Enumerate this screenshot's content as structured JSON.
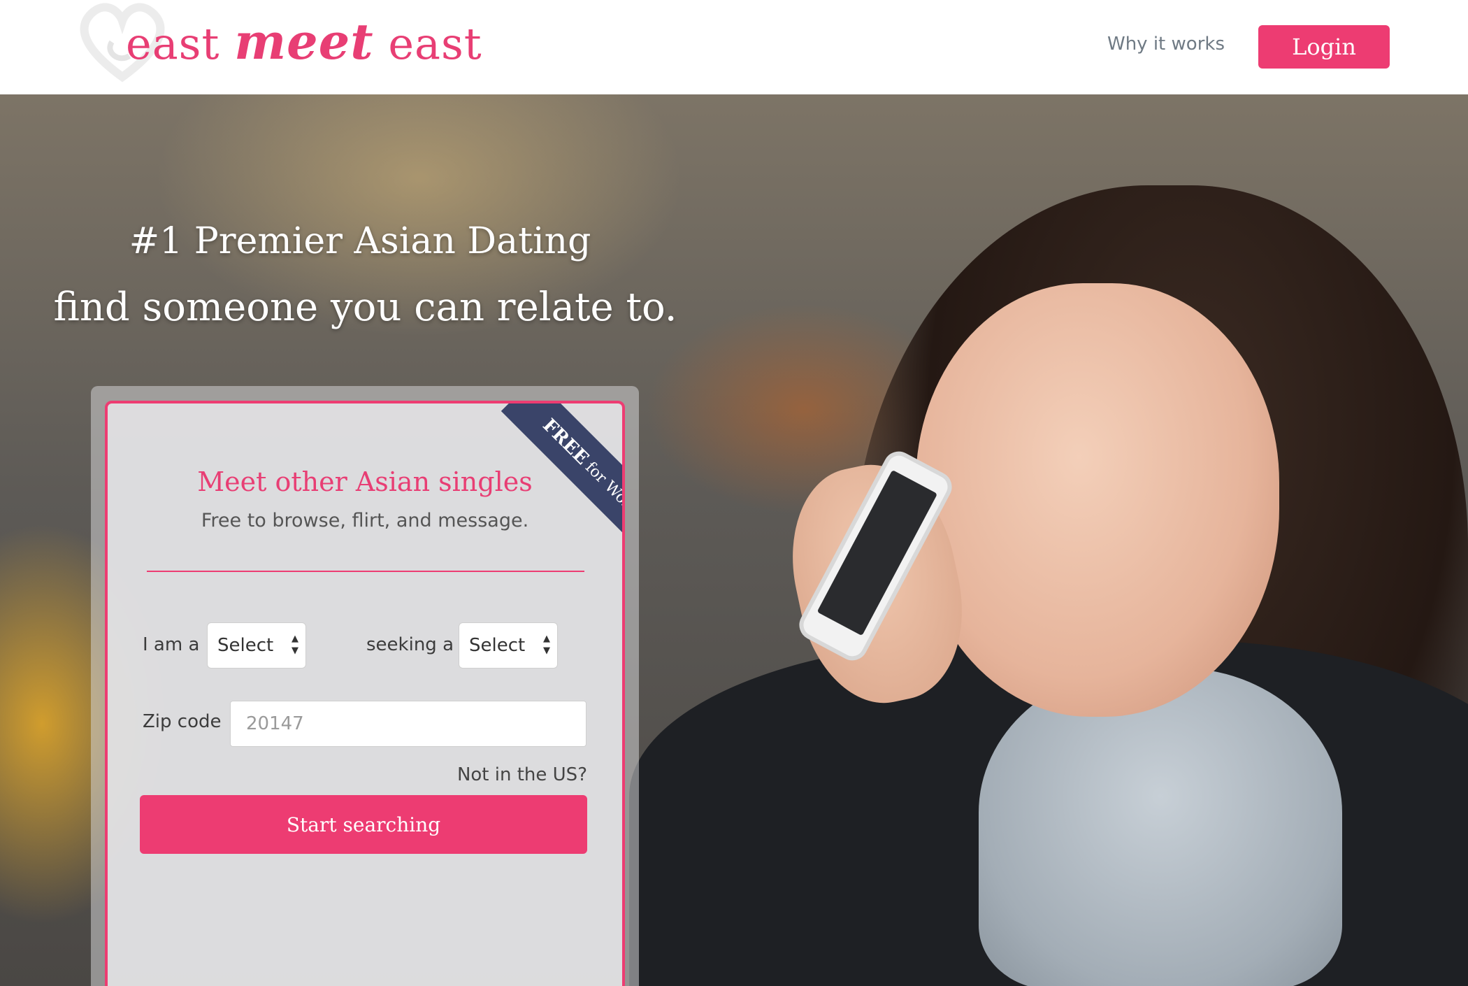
{
  "header": {
    "logo": {
      "part1": "east",
      "part2": "meet",
      "part3": "east"
    },
    "nav_why": "Why it works",
    "login": "Login"
  },
  "hero": {
    "headline1": "#1 Premier Asian Dating",
    "headline2": "find someone you can relate to."
  },
  "card": {
    "ribbon_free": "FREE",
    "ribbon_rest": "for Women",
    "title": "Meet other Asian singles",
    "subtitle": "Free to browse, flirt, and message.",
    "iam_label": "I am a",
    "iam_value": "Select",
    "seeking_label": "seeking a",
    "seeking_value": "Select",
    "zip_label": "Zip code",
    "zip_placeholder": "20147",
    "not_us": "Not in the US?",
    "submit": "Start searching"
  },
  "colors": {
    "accent": "#ed3c72",
    "ribbon": "#3a4469"
  }
}
